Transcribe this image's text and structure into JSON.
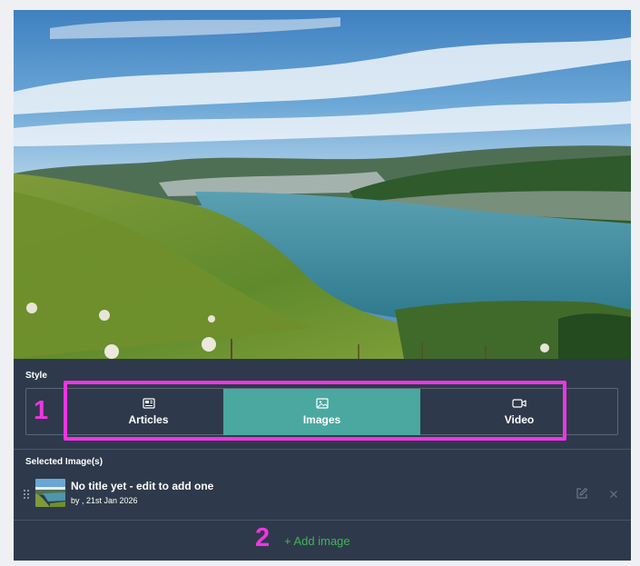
{
  "style_section": {
    "label": "Style",
    "options": [
      {
        "label": "Articles",
        "icon": "newspaper-icon",
        "selected": false
      },
      {
        "label": "Images",
        "icon": "image-icon",
        "selected": true
      },
      {
        "label": "Video",
        "icon": "video-camera-icon",
        "selected": false
      }
    ]
  },
  "annotations": {
    "marker_1": "1",
    "marker_2": "2",
    "highlight_color": "#f035e3"
  },
  "selected_images": {
    "label": "Selected Image(s)",
    "items": [
      {
        "title": "No title yet - edit to add one",
        "meta": "by , 21st Jan 2026"
      }
    ]
  },
  "add_image": {
    "label": "+ Add image",
    "color": "#43b25a"
  },
  "colors": {
    "panel_bg": "#2e3a4b",
    "selected_bg": "#4aa8a0"
  }
}
